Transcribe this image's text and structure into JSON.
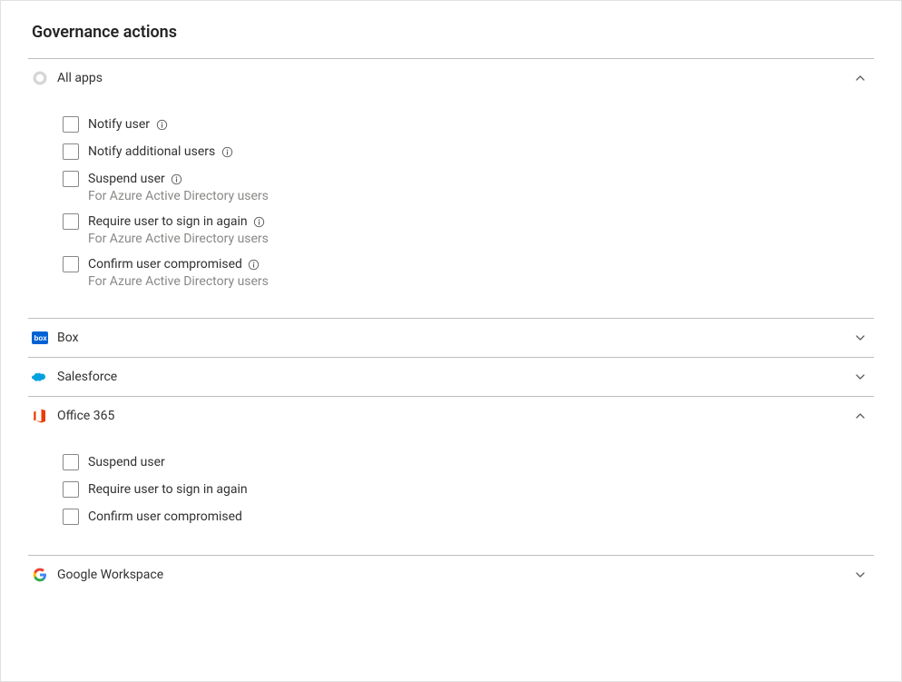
{
  "title": "Governance actions",
  "sections": {
    "all_apps": {
      "label": "All apps",
      "expanded": true,
      "options": [
        {
          "label": "Notify user",
          "has_info": true
        },
        {
          "label": "Notify additional users",
          "has_info": true
        },
        {
          "label": "Suspend user",
          "has_info": true,
          "subtext": "For Azure Active Directory users"
        },
        {
          "label": "Require user to sign in again",
          "has_info": true,
          "subtext": "For Azure Active Directory users"
        },
        {
          "label": "Confirm user compromised",
          "has_info": true,
          "subtext": "For Azure Active Directory users"
        }
      ]
    },
    "box": {
      "label": "Box",
      "expanded": false
    },
    "salesforce": {
      "label": "Salesforce",
      "expanded": false
    },
    "office_365": {
      "label": "Office 365",
      "expanded": true,
      "options": [
        {
          "label": "Suspend user"
        },
        {
          "label": "Require user to sign in again"
        },
        {
          "label": "Confirm user compromised"
        }
      ]
    },
    "google_workspace": {
      "label": "Google Workspace",
      "expanded": false
    }
  }
}
